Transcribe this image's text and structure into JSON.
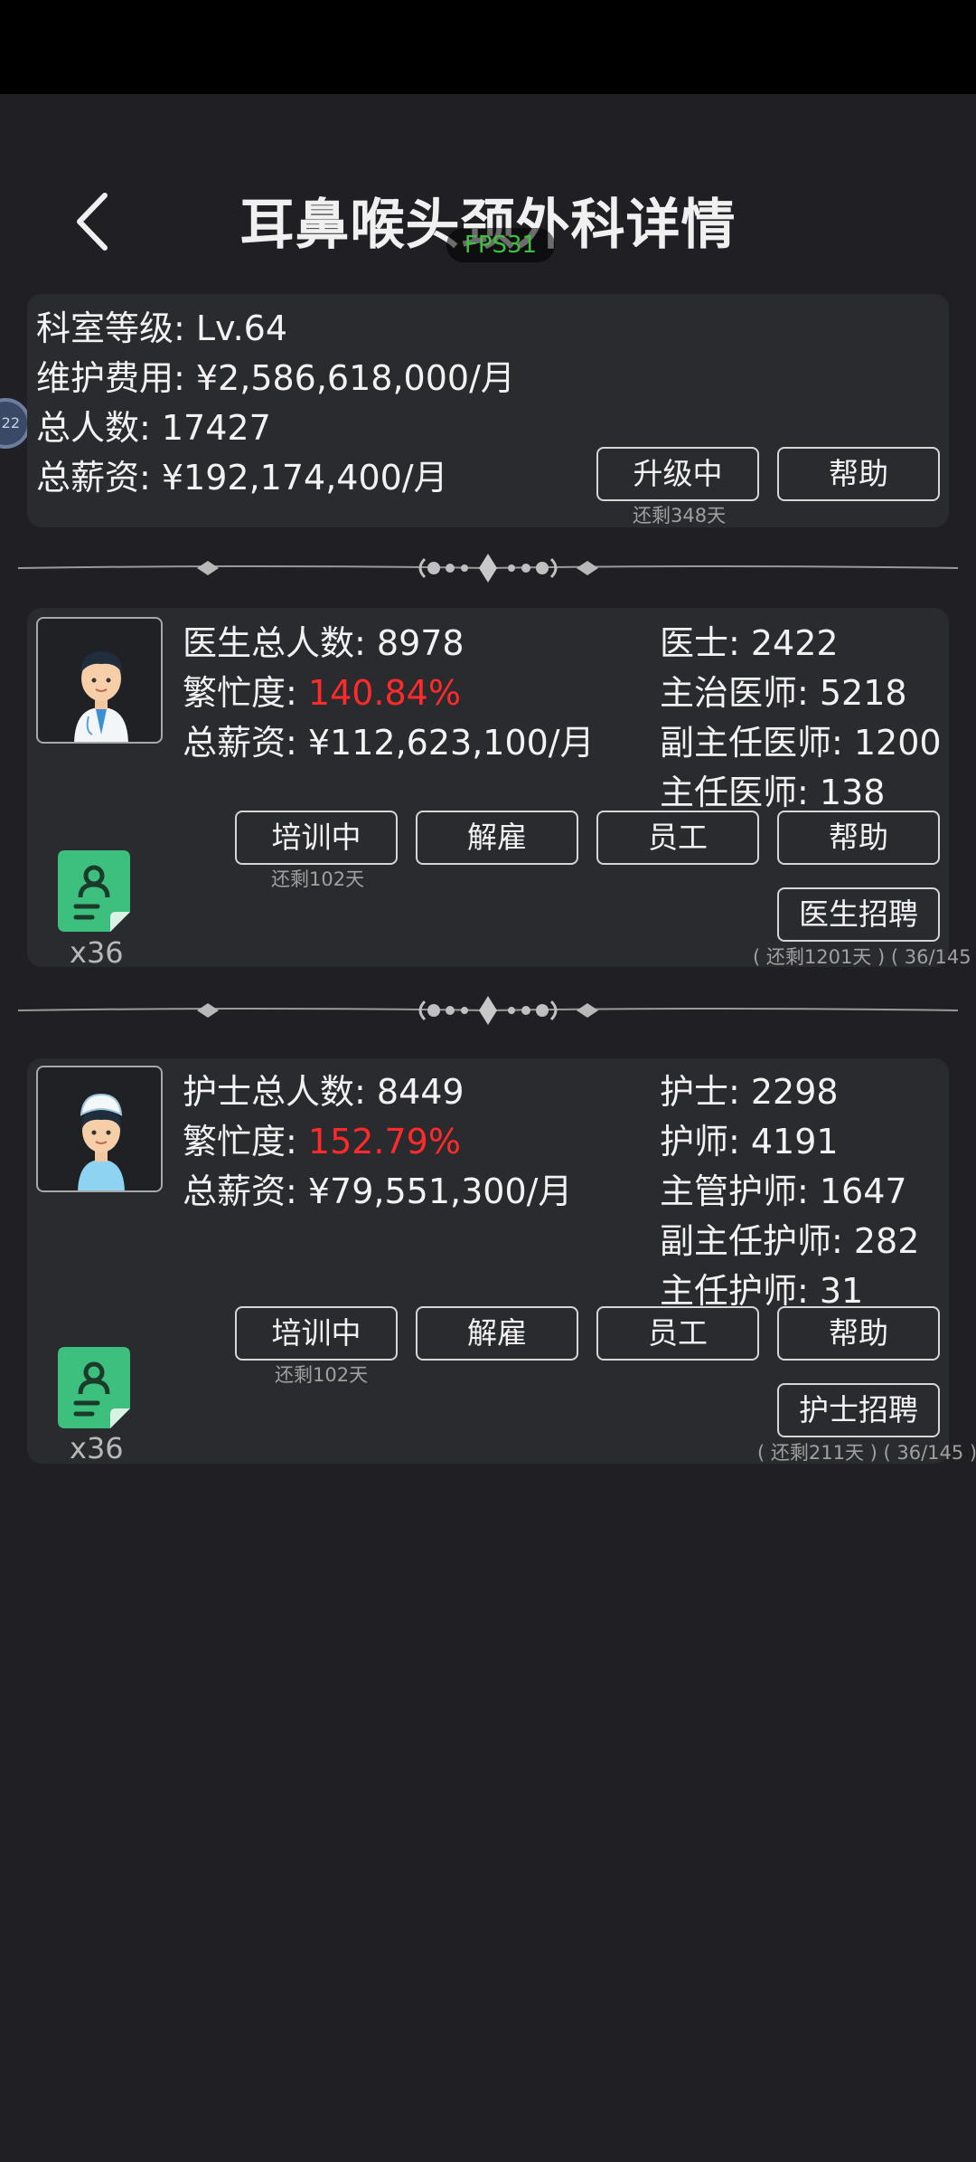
{
  "header": {
    "title": "耳鼻喉头颈外科详情",
    "fps": "FPS31"
  },
  "floatball": {
    "label": "22"
  },
  "dept": {
    "level": "科室等级: Lv.64",
    "maintenance": "维护费用: ¥2,586,618,000/月",
    "headcount": "总人数: 17427",
    "salary": "总薪资: ¥192,174,400/月",
    "upgrade_btn": "升级中",
    "upgrade_remaining": "还剩348天",
    "help_btn": "帮助"
  },
  "doctors": {
    "total_prefix": "医生总人数: ",
    "total": "8978",
    "busy_prefix": "繁忙度: ",
    "busy": "140.84%",
    "salary": "总薪资: ¥112,623,100/月",
    "ranks": [
      "医士: 2422",
      "主治医师: 5218",
      "副主任医师: 1200",
      "主任医师: 138"
    ],
    "train_btn": "培训中",
    "train_remaining": "还剩102天",
    "fire_btn": "解雇",
    "staff_btn": "员工",
    "help_btn": "帮助",
    "recruit_btn": "医生招聘",
    "recruit_info": "( 还剩1201天 ) ( 36/145",
    "cert_count": "x36"
  },
  "nurses": {
    "total_prefix": "护士总人数: ",
    "total": "8449",
    "busy_prefix": "繁忙度: ",
    "busy": "152.79%",
    "salary": "总薪资: ¥79,551,300/月",
    "ranks": [
      "护士: 2298",
      "护师: 4191",
      "主管护师: 1647",
      "副主任护师: 282",
      "主任护师: 31"
    ],
    "train_btn": "培训中",
    "train_remaining": "还剩102天",
    "fire_btn": "解雇",
    "staff_btn": "员工",
    "help_btn": "帮助",
    "recruit_btn": "护士招聘",
    "recruit_info": "( 还剩211天 ) ( 36/145 )",
    "cert_count": "x36"
  },
  "colors": {
    "busy_red": "#ff2a2a",
    "cert_green": "#3dbf7e",
    "fps_green": "#3fbf3f"
  }
}
